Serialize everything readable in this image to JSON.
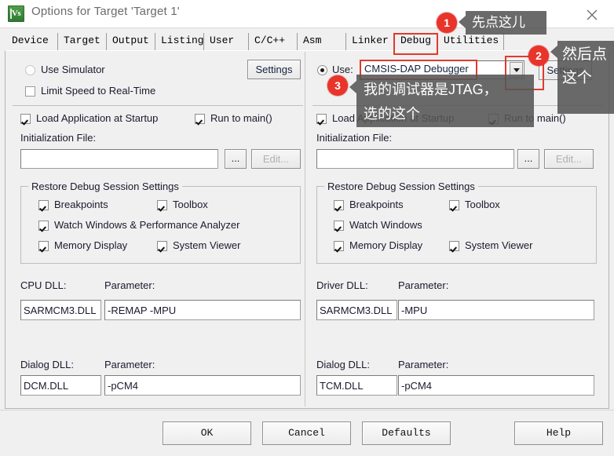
{
  "window": {
    "title": "Options for Target 'Target 1'",
    "icon": "keil-uvision-icon",
    "close_icon": "close-icon"
  },
  "tabs": [
    {
      "label": "Device",
      "selected": false
    },
    {
      "label": "Target",
      "selected": false
    },
    {
      "label": "Output",
      "selected": false
    },
    {
      "label": "Listing",
      "selected": false
    },
    {
      "label": "User",
      "selected": false
    },
    {
      "label": "C/C++",
      "selected": false
    },
    {
      "label": "Asm",
      "selected": false
    },
    {
      "label": "Linker",
      "selected": false
    },
    {
      "label": "Debug",
      "selected": true
    },
    {
      "label": "Utilities",
      "selected": false
    }
  ],
  "left_pane": {
    "use_simulator_label": "Use Simulator",
    "use_simulator_checked": false,
    "limit_speed_label": "Limit Speed to Real-Time",
    "limit_speed_checked": false,
    "settings_button": "Settings",
    "load_app_label": "Load Application at Startup",
    "load_app_checked": true,
    "run_to_main_label": "Run to main()",
    "run_to_main_checked": true,
    "init_file_label": "Initialization File:",
    "init_file_value": "",
    "browse_button": "...",
    "edit_button": "Edit...",
    "restore_group": {
      "title": "Restore Debug Session Settings",
      "items": [
        {
          "label": "Breakpoints",
          "checked": true
        },
        {
          "label": "Toolbox",
          "checked": true
        },
        {
          "label": "Watch Windows & Performance Analyzer",
          "checked": true
        },
        {
          "label": "Memory Display",
          "checked": true
        },
        {
          "label": "System Viewer",
          "checked": true
        }
      ]
    },
    "cpu_dll_label": "CPU DLL:",
    "cpu_dll_value": "SARMCM3.DLL",
    "cpu_param_label": "Parameter:",
    "cpu_param_value": "-REMAP -MPU",
    "dialog_dll_label": "Dialog DLL:",
    "dialog_dll_value": "DCM.DLL",
    "dialog_param_label": "Parameter:",
    "dialog_param_value": "-pCM4"
  },
  "right_pane": {
    "use_label": "Use:",
    "use_checked": true,
    "debugger_value": "CMSIS-DAP Debugger",
    "dropdown_icon": "chevron-down-icon",
    "settings_button": "Settings",
    "load_app_label": "Load Application at Startup",
    "load_app_checked": true,
    "run_to_main_label": "Run to main()",
    "run_to_main_checked": true,
    "init_file_label": "Initialization File:",
    "init_file_value": "",
    "browse_button": "...",
    "edit_button": "Edit...",
    "restore_group": {
      "title": "Restore Debug Session Settings",
      "items": [
        {
          "label": "Breakpoints",
          "checked": true
        },
        {
          "label": "Toolbox",
          "checked": true
        },
        {
          "label": "Watch Windows",
          "checked": true
        },
        {
          "label": "Memory Display",
          "checked": true
        },
        {
          "label": "System Viewer",
          "checked": true
        }
      ]
    },
    "driver_dll_label": "Driver DLL:",
    "driver_dll_value": "SARMCM3.DLL",
    "driver_param_label": "Parameter:",
    "driver_param_value": "-MPU",
    "dialog_dll_label": "Dialog DLL:",
    "dialog_dll_value": "TCM.DLL",
    "dialog_param_label": "Parameter:",
    "dialog_param_value": "-pCM4"
  },
  "footer": {
    "ok": "OK",
    "cancel": "Cancel",
    "defaults": "Defaults",
    "help": "Help"
  },
  "annotations": {
    "badge1": "1",
    "tip1": "先点这儿",
    "badge2": "2",
    "tip2": "然后点这个",
    "badge3": "3",
    "tip3": "我的调试器是JTAG，\n选的这个",
    "highlight_color": "#e03a2f",
    "badge_color": "#e8342a"
  }
}
